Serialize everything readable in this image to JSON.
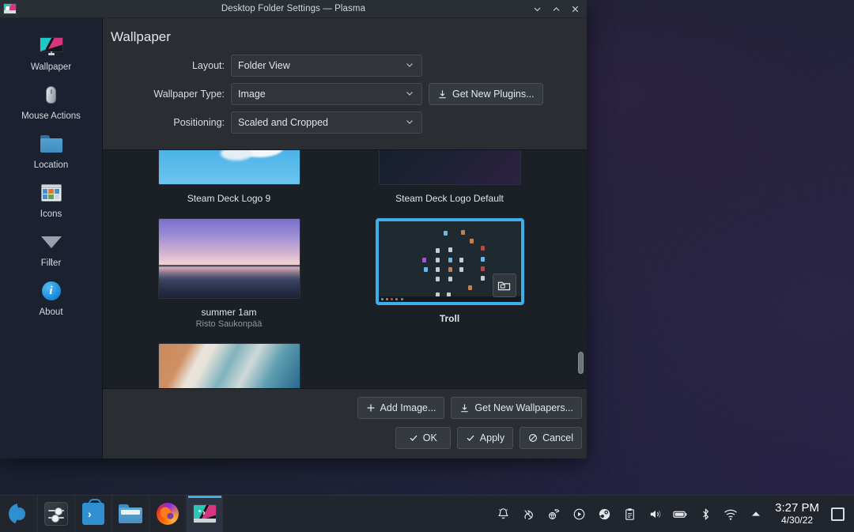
{
  "window": {
    "title": "Desktop Folder Settings — Plasma",
    "app_icon": "plasma-desktop-icon",
    "controls": {
      "minimize": "minimize-icon",
      "maximize": "maximize-icon",
      "close": "close-icon"
    }
  },
  "sidebar": {
    "items": [
      {
        "label": "Wallpaper",
        "icon": "monitor-icon",
        "selected": true
      },
      {
        "label": "Mouse Actions",
        "icon": "mouse-icon",
        "selected": false
      },
      {
        "label": "Location",
        "icon": "folder-icon",
        "selected": false
      },
      {
        "label": "Icons",
        "icon": "icons-grid-icon",
        "selected": false
      },
      {
        "label": "Filter",
        "icon": "funnel-icon",
        "selected": false
      },
      {
        "label": "About",
        "icon": "info-icon",
        "selected": false
      }
    ]
  },
  "page": {
    "title": "Wallpaper",
    "form": {
      "layout": {
        "label": "Layout:",
        "value": "Folder View"
      },
      "wallpaper_type": {
        "label": "Wallpaper Type:",
        "value": "Image"
      },
      "positioning": {
        "label": "Positioning:",
        "value": "Scaled and Cropped"
      },
      "get_new_plugins": "Get New Plugins..."
    },
    "wallpapers": [
      {
        "name": "Steam Deck Logo 9",
        "author": "",
        "selected": false,
        "style": "th-sky"
      },
      {
        "name": "Steam Deck Logo Default",
        "author": "",
        "selected": false,
        "style": "th-purple"
      },
      {
        "name": "summer 1am",
        "author": "Risto Saukonpää",
        "selected": false,
        "style": "th-summer"
      },
      {
        "name": "Troll",
        "author": "",
        "selected": true,
        "style": "th-troll"
      }
    ],
    "actions": {
      "add_image": "Add Image...",
      "get_new_wallpapers": "Get New Wallpapers..."
    },
    "dialog_buttons": {
      "ok": "OK",
      "apply": "Apply",
      "cancel": "Cancel"
    }
  },
  "taskbar": {
    "tasks": [
      {
        "name": "kickoff-launcher",
        "icon": "kde-launcher-icon"
      },
      {
        "name": "system-settings",
        "icon": "settings-sliders-icon"
      },
      {
        "name": "discover",
        "icon": "discover-bag-icon"
      },
      {
        "name": "dolphin",
        "icon": "folder-manager-icon"
      },
      {
        "name": "firefox",
        "icon": "firefox-icon"
      },
      {
        "name": "desktop-settings",
        "icon": "plasma-desktop-icon",
        "active": true
      }
    ],
    "tray": [
      {
        "name": "notifications",
        "icon": "bell-icon"
      },
      {
        "name": "kde-connect",
        "icon": "flame-icon"
      },
      {
        "name": "network-share",
        "icon": "globe-arrow-icon"
      },
      {
        "name": "media-player",
        "icon": "play-circle-icon"
      },
      {
        "name": "steam",
        "icon": "steam-icon"
      },
      {
        "name": "clipboard",
        "icon": "clipboard-icon"
      },
      {
        "name": "volume",
        "icon": "speaker-icon"
      },
      {
        "name": "battery",
        "icon": "battery-icon"
      },
      {
        "name": "bluetooth",
        "icon": "bluetooth-icon"
      },
      {
        "name": "wifi",
        "icon": "wifi-icon"
      },
      {
        "name": "show-hidden",
        "icon": "chevron-up-icon"
      }
    ],
    "clock": {
      "time": "3:27 PM",
      "date": "4/30/22"
    },
    "show_desktop": "show-desktop-icon"
  },
  "colors": {
    "accent": "#3daee9",
    "window_bg": "#2a2e32",
    "sidebar_bg": "#1b2130",
    "grid_bg": "#1b2027"
  }
}
